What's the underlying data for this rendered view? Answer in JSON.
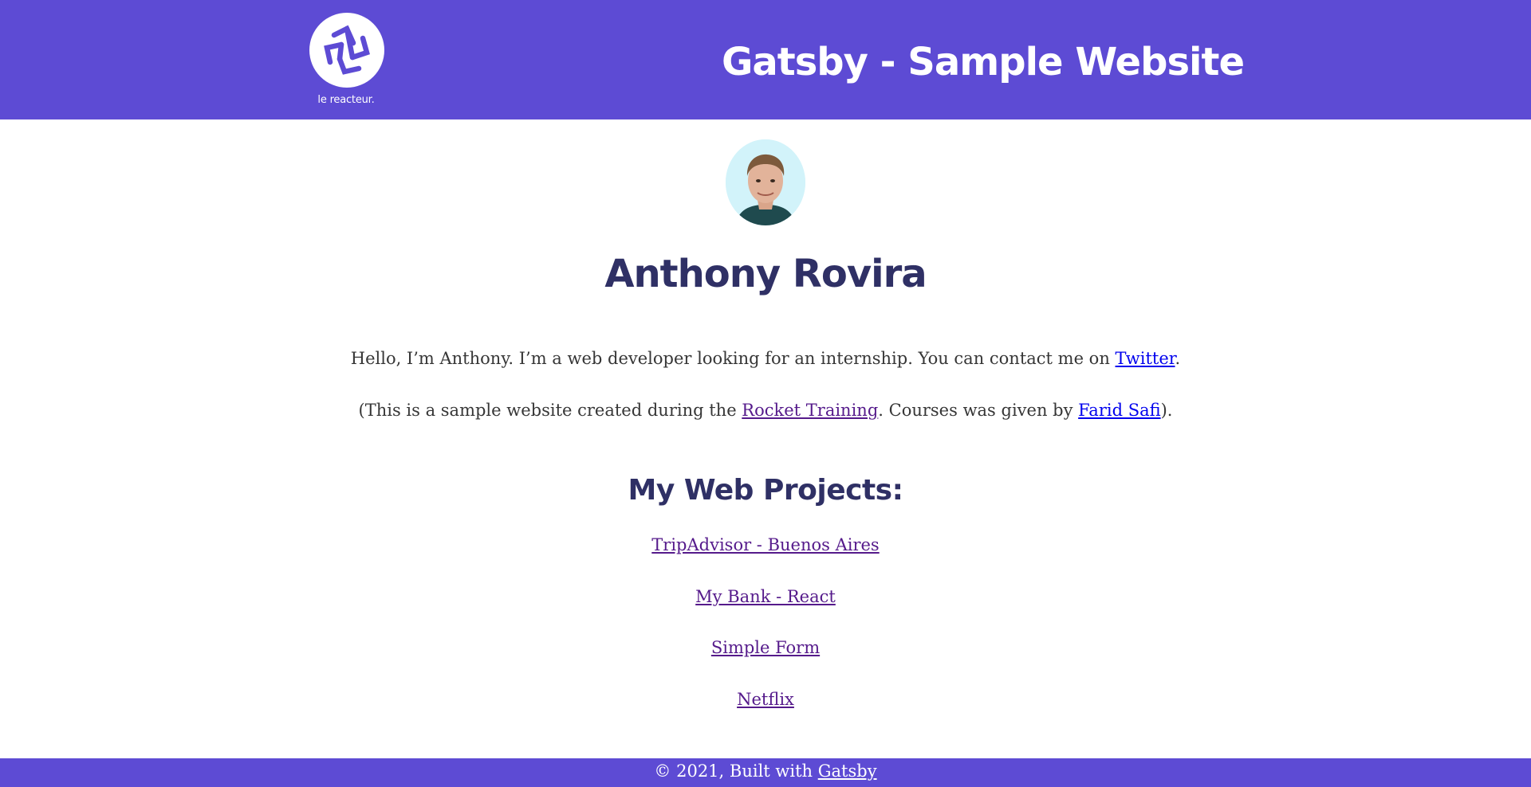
{
  "header": {
    "logo_text": "le reacteur.",
    "title": "Gatsby - Sample Website"
  },
  "profile": {
    "name": "Anthony Rovira",
    "intro_text": "Hello, I’m Anthony. I’m a web developer looking for an internship. You can contact me on ",
    "twitter_link": "Twitter",
    "intro_end": ".",
    "sample_prefix": "(This is a sample website created during the ",
    "rocket_link": "Rocket Training",
    "sample_middle": ". Courses was given by ",
    "farid_link": "Farid Safi",
    "sample_end": ")."
  },
  "projects": {
    "title": "My Web Projects:",
    "items": [
      {
        "label": "TripAdvisor - Buenos Aires"
      },
      {
        "label": "My Bank - React"
      },
      {
        "label": "Simple Form"
      },
      {
        "label": "Netflix"
      }
    ]
  },
  "footer": {
    "prefix": "© 2021, Built with ",
    "link": "Gatsby"
  },
  "colors": {
    "brand_purple": "#5d4bd4",
    "heading_navy": "#2f3065",
    "link_blue": "#0000ee",
    "link_visited": "#551a8b"
  }
}
